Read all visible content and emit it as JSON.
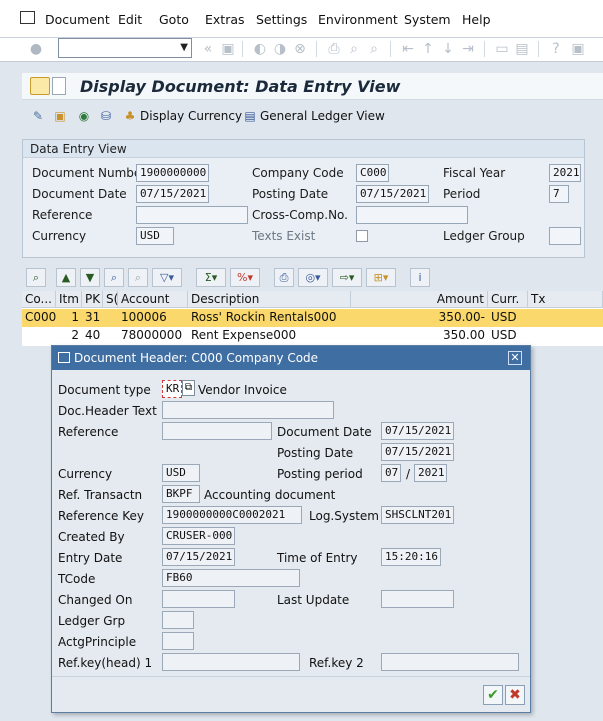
{
  "menu": [
    "Document",
    "Edit",
    "Goto",
    "Extras",
    "Settings",
    "Environment",
    "System",
    "Help"
  ],
  "title": "Display Document: Data Entry View",
  "app_toolbar": {
    "display_currency": "Display Currency",
    "general_ledger_view": "General Ledger View"
  },
  "data_entry": {
    "header": "Data Entry View",
    "document_number_label": "Document Number",
    "document_number": "1900000000",
    "company_code_label": "Company Code",
    "company_code": "C000",
    "fiscal_year_label": "Fiscal Year",
    "fiscal_year": "2021",
    "document_date_label": "Document Date",
    "document_date": "07/15/2021",
    "posting_date_label": "Posting Date",
    "posting_date": "07/15/2021",
    "period_label": "Period",
    "period": "7",
    "reference_label": "Reference",
    "reference": "",
    "cross_comp_label": "Cross-Comp.No.",
    "cross_comp": "",
    "currency_label": "Currency",
    "currency": "USD",
    "texts_exist_label": "Texts Exist",
    "ledger_group_label": "Ledger Group",
    "ledger_group": ""
  },
  "table": {
    "columns": [
      "Co...",
      "Itm",
      "PK",
      "S(",
      "Account",
      "Description",
      "Amount",
      "Curr.",
      "Tx"
    ],
    "rows": [
      {
        "co": "C000",
        "itm": "1",
        "pk": "31",
        "s": "",
        "account": "100006",
        "description": "Ross' Rockin Rentals000",
        "amount": "350.00-",
        "curr": "USD",
        "tx": ""
      },
      {
        "co": "",
        "itm": "2",
        "pk": "40",
        "s": "",
        "account": "78000000",
        "description": "Rent Expense000",
        "amount": "350.00",
        "curr": "USD",
        "tx": ""
      }
    ]
  },
  "dialog": {
    "title": "Document Header: C000 Company Code",
    "document_type_label": "Document type",
    "document_type": "KR",
    "document_type_text": "Vendor Invoice",
    "doc_header_text_label": "Doc.Header Text",
    "doc_header_text": "",
    "reference_label": "Reference",
    "reference": "",
    "document_date_label": "Document Date",
    "document_date": "07/15/2021",
    "posting_date_label": "Posting Date",
    "posting_date": "07/15/2021",
    "currency_label": "Currency",
    "currency": "USD",
    "posting_period_label": "Posting period",
    "posting_period": "07",
    "posting_period_sep": "/",
    "posting_period_year": "2021",
    "ref_transactn_label": "Ref. Transactn",
    "ref_transactn": "BKPF",
    "ref_transactn_text": "Accounting document",
    "reference_key_label": "Reference Key",
    "reference_key": "1900000000C0002021",
    "log_system_label": "Log.System",
    "log_system": "SHSCLNT201",
    "created_by_label": "Created By",
    "created_by": "CRUSER-000",
    "entry_date_label": "Entry Date",
    "entry_date": "07/15/2021",
    "time_of_entry_label": "Time of Entry",
    "time_of_entry": "15:20:16",
    "tcode_label": "TCode",
    "tcode": "FB60",
    "changed_on_label": "Changed On",
    "changed_on": "",
    "last_update_label": "Last Update",
    "last_update": "",
    "ledger_grp_label": "Ledger Grp",
    "ledger_grp": "",
    "actg_principle_label": "ActgPrinciple",
    "actg_principle": "",
    "ref_key_head_label": "Ref.key(head) 1",
    "ref_key_head": "",
    "ref_key2_label": "Ref.key 2",
    "ref_key2": ""
  },
  "colors": {
    "selected_row": "#fbd86b",
    "dialog_title": "#3f6ea3",
    "accept": "#3a9a2a",
    "cancel": "#c0392b"
  }
}
